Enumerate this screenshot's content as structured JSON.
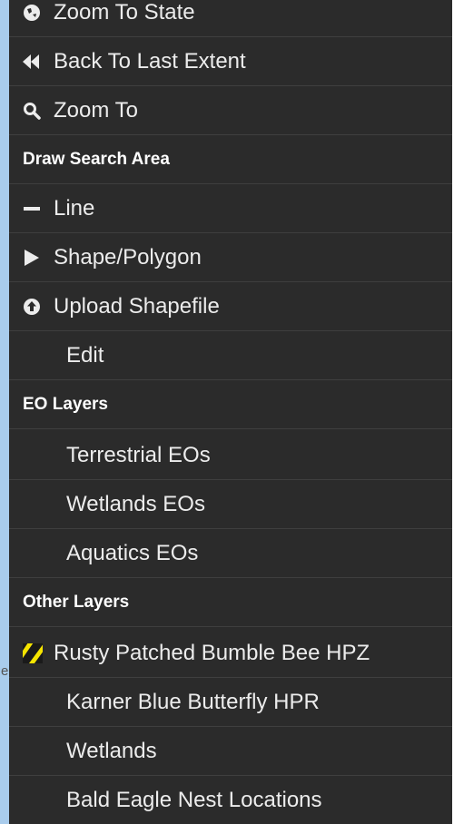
{
  "menu": {
    "items": [
      {
        "type": "item",
        "label": "Zoom To State",
        "icon": "globe-icon"
      },
      {
        "type": "item",
        "label": "Back To Last Extent",
        "icon": "fast-backward-icon"
      },
      {
        "type": "item",
        "label": "Zoom To",
        "icon": "search-icon"
      },
      {
        "type": "header",
        "label": "Draw Search Area"
      },
      {
        "type": "item",
        "label": "Line",
        "icon": "minus-icon"
      },
      {
        "type": "item",
        "label": "Shape/Polygon",
        "icon": "play-icon"
      },
      {
        "type": "item",
        "label": "Upload Shapefile",
        "icon": "upload-circle-icon"
      },
      {
        "type": "item",
        "label": "Edit",
        "icon": null
      },
      {
        "type": "header",
        "label": "EO Layers"
      },
      {
        "type": "item",
        "label": "Terrestrial EOs",
        "icon": null
      },
      {
        "type": "item",
        "label": "Wetlands EOs",
        "icon": null
      },
      {
        "type": "item",
        "label": "Aquatics EOs",
        "icon": null
      },
      {
        "type": "header",
        "label": "Other Layers"
      },
      {
        "type": "item",
        "label": "Rusty Patched Bumble Bee HPZ",
        "icon": "hazard-stripes-icon",
        "icon_colors": [
          "#f5e400",
          "#1a1a1a"
        ]
      },
      {
        "type": "item",
        "label": "Karner Blue Butterfly HPR",
        "icon": null
      },
      {
        "type": "item",
        "label": "Wetlands",
        "icon": null
      },
      {
        "type": "item",
        "label": "Bald Eagle Nest Locations",
        "icon": null
      }
    ]
  },
  "colors": {
    "menu_background": "#2b2b2b",
    "divider": "#3f3f3f",
    "map_water": "#a9ccec"
  }
}
